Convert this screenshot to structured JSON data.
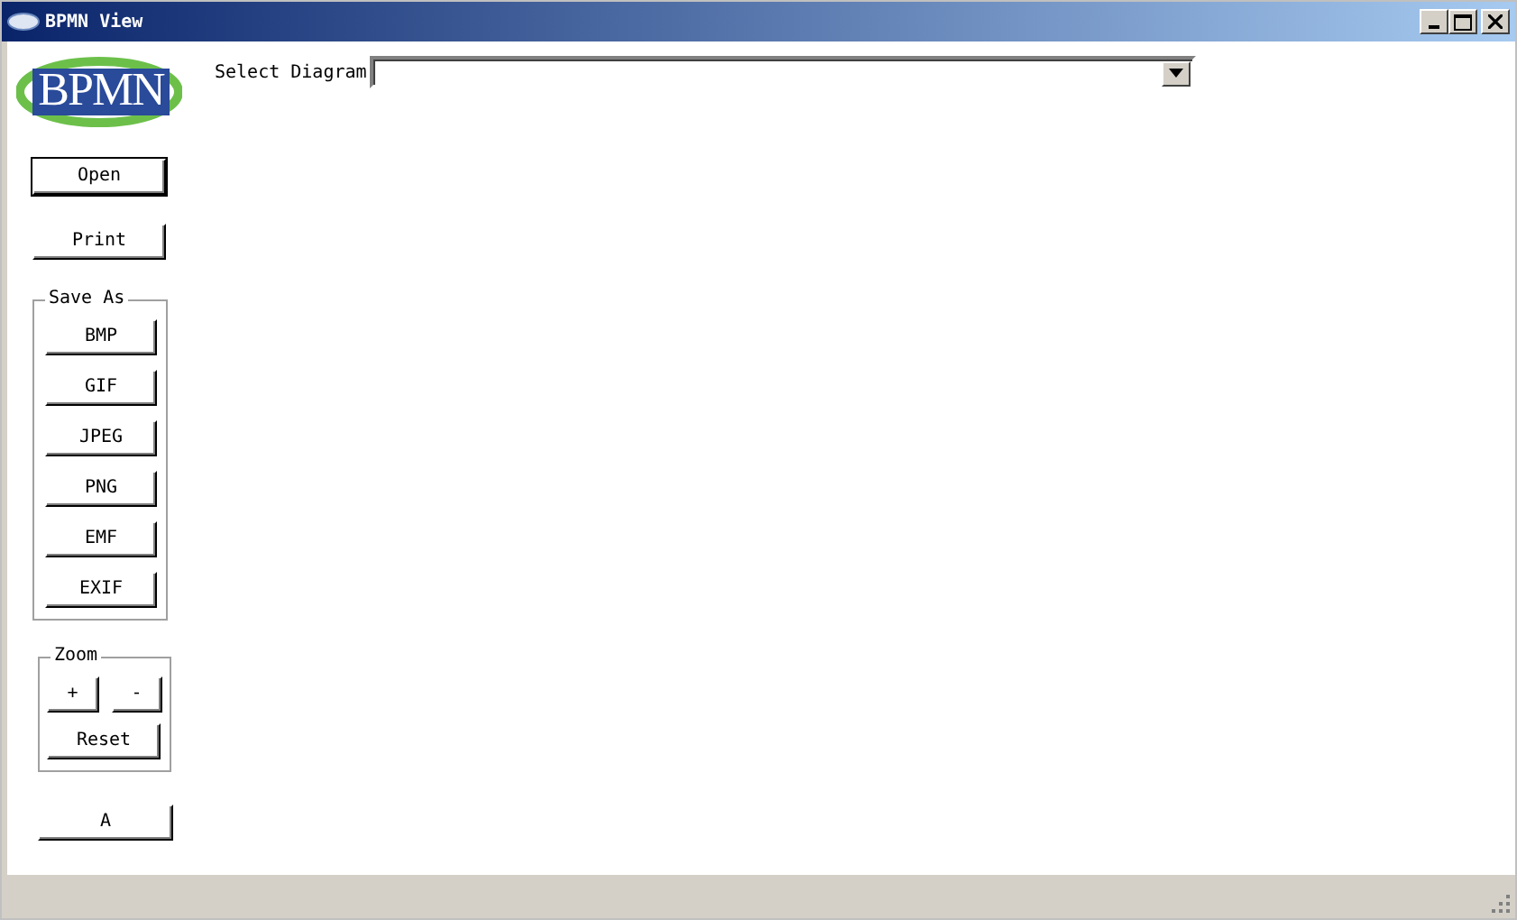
{
  "window": {
    "title": "BPMN View"
  },
  "logo": {
    "text": "BPMN"
  },
  "actions": [
    {
      "label": "Open",
      "default": true
    },
    {
      "label": "Print",
      "default": false
    }
  ],
  "save_as": {
    "title": "Save As",
    "buttons": [
      "BMP",
      "GIF",
      "JPEG",
      "PNG",
      "EMF",
      "EXIF"
    ]
  },
  "zoom": {
    "title": "Zoom",
    "buttons": [
      "+",
      "-"
    ],
    "reset": "Reset"
  },
  "bottom_button": {
    "label": "A"
  },
  "diagram_select": {
    "label": "Select Diagram"
  }
}
